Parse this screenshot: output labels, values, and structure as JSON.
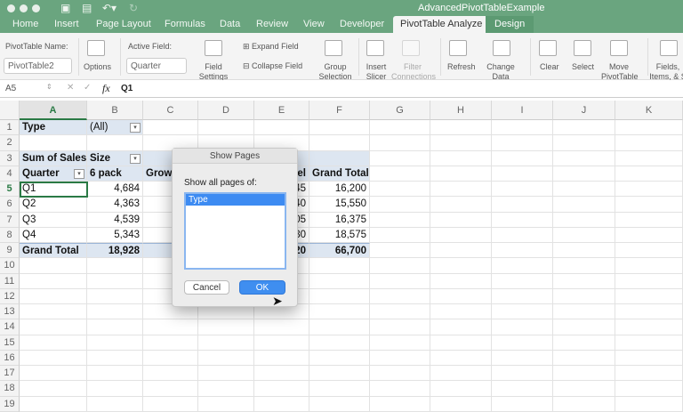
{
  "window": {
    "title": "AdvancedPivotTableExample"
  },
  "tabs": [
    "Home",
    "Insert",
    "Page Layout",
    "Formulas",
    "Data",
    "Review",
    "View",
    "Developer",
    "PivotTable Analyze",
    "Design"
  ],
  "ribbon": {
    "pivot_name_label": "PivotTable Name:",
    "pivot_name_value": "PivotTable2",
    "options": "Options",
    "active_field_label": "Active Field:",
    "active_field_value": "Quarter",
    "field_settings": "Field Settings",
    "expand_field": "Expand Field",
    "collapse_field": "Collapse Field",
    "group_selection": "Group Selection",
    "insert_slicer": "Insert Slicer",
    "filter_connections": "Filter Connections",
    "refresh": "Refresh",
    "change_data_source": "Change Data Source",
    "clear": "Clear",
    "select": "Select",
    "move_pivottable": "Move PivotTable",
    "fields_items": "Fields, Items, & S"
  },
  "formula_bar": {
    "name_box": "A5",
    "fx": "fx",
    "value": "Q1"
  },
  "columns": [
    "A",
    "B",
    "C",
    "D",
    "E",
    "F",
    "G",
    "H",
    "I",
    "J",
    "K"
  ],
  "rows": [
    [
      "Type",
      "(All)",
      "",
      "",
      "",
      ""
    ],
    [
      "",
      "",
      "",
      "",
      "",
      ""
    ],
    [
      "Sum of Sales",
      "Size",
      "",
      "",
      "",
      ""
    ],
    [
      "Quarter",
      "6 pack",
      "Grow",
      "",
      "el",
      "Grand Total"
    ],
    [
      "Q1",
      "4,684",
      "",
      "",
      "45",
      "16,200"
    ],
    [
      "Q2",
      "4,363",
      "",
      "",
      "40",
      "15,550"
    ],
    [
      "Q3",
      "4,539",
      "",
      "",
      "05",
      "16,375"
    ],
    [
      "Q4",
      "5,343",
      "",
      "",
      "30",
      "18,575"
    ],
    [
      "Grand Total",
      "18,928",
      "8",
      "",
      "20",
      "66,700"
    ],
    [
      "",
      "",
      "",
      "",
      "",
      ""
    ],
    [
      "",
      "",
      "",
      "",
      "",
      ""
    ],
    [
      "",
      "",
      "",
      "",
      "",
      ""
    ],
    [
      "",
      "",
      "",
      "",
      "",
      ""
    ],
    [
      "",
      "",
      "",
      "",
      "",
      ""
    ],
    [
      "",
      "",
      "",
      "",
      "",
      ""
    ],
    [
      "",
      "",
      "",
      "",
      "",
      ""
    ],
    [
      "",
      "",
      "",
      "",
      "",
      ""
    ],
    [
      "",
      "",
      "",
      "",
      "",
      ""
    ],
    [
      "",
      "",
      "",
      "",
      "",
      ""
    ]
  ],
  "dialog": {
    "title": "Show Pages",
    "label": "Show all pages of:",
    "items": [
      "Type"
    ],
    "cancel": "Cancel",
    "ok": "OK"
  }
}
